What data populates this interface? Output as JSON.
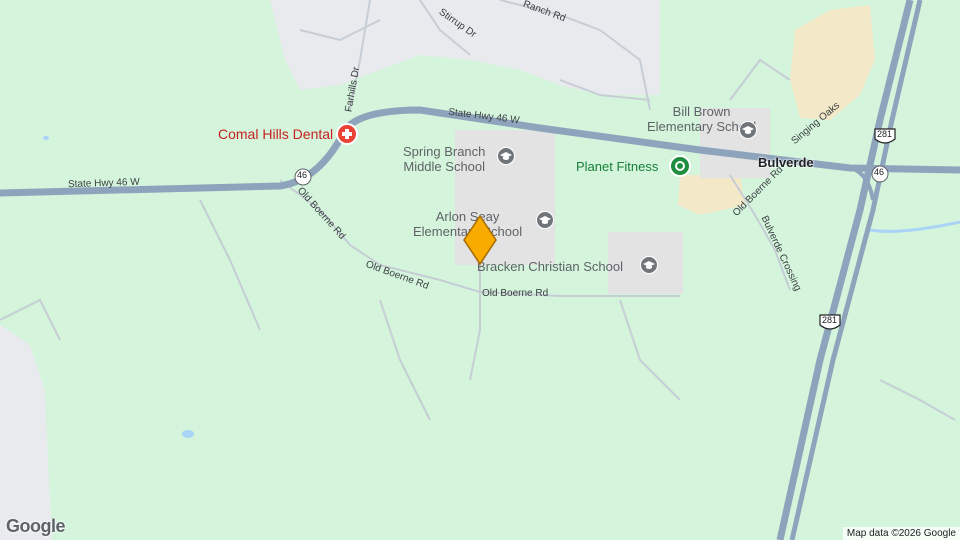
{
  "map": {
    "colors": {
      "land": "#d4f5dc",
      "urban": "#e8eaed",
      "campus": "#e3e3e3",
      "commercial": "#f3e8c8",
      "highway": "#8ea4bc",
      "road": "#c6cdd5",
      "water": "#aad3f7",
      "pin": "#f9ab00"
    },
    "pois": {
      "dental": {
        "label": "Comal Hills Dental",
        "icon": "medical-cross-icon"
      },
      "spring_branch_line1": "Spring Branch",
      "spring_branch_line2": "Middle School",
      "arlon_line1": "Arlon Seay",
      "arlon_line2": "Elementary School",
      "bill_brown_line1": "Bill Brown",
      "bill_brown_line2": "Elementary School",
      "planet_fitness": "Planet Fitness",
      "bracken": "Bracken Christian School"
    },
    "roads": {
      "hwy46_west": "State Hwy 46 W",
      "hwy46_east": "State Hwy 46 W",
      "old_boerne_1": "Old Boerne Rd",
      "old_boerne_2": "Old Boerne Rd",
      "old_boerne_3": "Old Boerne Rd",
      "old_boerne_east": "Old Boerne Rd",
      "farhills": "Farhills Dr",
      "stirrup": "Stirrup Dr",
      "ranch": "Ranch Rd",
      "singing_oaks": "Singing Oaks",
      "bulverde_crossing": "Bulverde Crossing"
    },
    "shields": {
      "s46_a": "46",
      "s46_b": "46",
      "s281_a": "281",
      "s281_b": "281"
    },
    "town": "Bulverde",
    "attribution": "Map data ©2026 Google",
    "logo": "Google"
  }
}
